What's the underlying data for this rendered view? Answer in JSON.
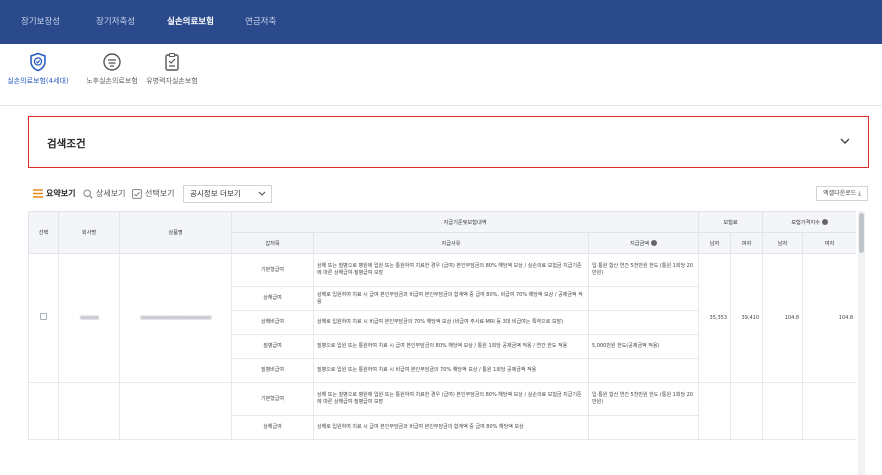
{
  "topnav": {
    "tabs": [
      {
        "label": "장기보장성",
        "active": false
      },
      {
        "label": "장기저축성",
        "active": false
      },
      {
        "label": "실손의료보험",
        "active": true
      },
      {
        "label": "연금저축",
        "active": false
      }
    ]
  },
  "subnav": {
    "items": [
      {
        "label": "실손의료보험(4세대)",
        "icon": "shield-check-icon",
        "active": true
      },
      {
        "label": "노후실손의료보험",
        "icon": "elderly-face-icon",
        "active": false
      },
      {
        "label": "유병력자실손보험",
        "icon": "clipboard-icon",
        "active": false
      }
    ]
  },
  "search": {
    "title": "검색조건"
  },
  "toolbar": {
    "summary": "요약보기",
    "detail": "상세보기",
    "select": "선택보기",
    "disclosure": "공시정보 더보기",
    "excel": "엑셀다운로드"
  },
  "table": {
    "headers": {
      "select": "선택",
      "company": "회사명",
      "product": "상품명",
      "coverage_group": "지급기준및보험내역",
      "premium_group": "보험료",
      "index_group": "보험가격지수",
      "coverage_type": "갑저목",
      "payment_reason": "지급사유",
      "payment_amount": "지급금액",
      "male": "남자",
      "female": "여자"
    },
    "rows": [
      {
        "type": "기본형급여",
        "reason": "상해 또는 질병으로 병원에 입원 또는 통원하여 치료한 경우 (급여) 본인부담금의 80% 해당액 보상 / 실손의료 보험금 지급기준에 따른 상해급여·질병급여 보장",
        "amount": "입·통원 합산 연간 5천만원 한도 (통원 1회당 20만원)"
      },
      {
        "type": "상해급여",
        "reason": "상해로 입원하여 치료 시 급여 본인부담금과 비급여 본인부담금의 합계액 중 급여 80%, 비급여 70% 해당액 보상 / 공제금액 적용",
        "amount": ""
      },
      {
        "type": "상해비급여",
        "reason": "상해로 입원하여 치료 시 비급여 본인부담금의 70% 해당액 보상 (비급여 주사료·MRI 등 3대 비급여는 특약으로 보장)",
        "amount": ""
      },
      {
        "type": "질병급여",
        "reason": "질병으로 입원 또는 통원하여 치료 시 급여 본인부담금의 80% 해당액 보상 / 통원 1회당 공제금액 적용 / 연간 한도 적용",
        "amount": "5,000만원 한도(공제금액 적용)"
      },
      {
        "type": "질병비급여",
        "reason": "질병으로 입원 또는 통원하여 치료 시 비급여 본인부담금의 70% 해당액 보상 / 통원 1회당 공제금액 적용",
        "amount": ""
      },
      {
        "type": "기본형급여",
        "reason": "상해 또는 질병으로 병원에 입원 또는 통원하여 치료한 경우 (급여) 본인부담금의 80% 해당액 보상 / 실손의료 보험금 지급기준에 따른 상해급여·질병급여 보장",
        "amount": "입·통원 합산 연간 5천만원 한도 (통원 1회당 20만원)"
      },
      {
        "type": "상해급여",
        "reason": "상해로 입원하여 치료 시 급여 본인부담금과 비급여 본인부담금의 합계액 중 급여 80% 해당액 보상",
        "amount": ""
      }
    ],
    "product1": {
      "company": "■■■■■",
      "name": "■■■■■■■■■■■■■■■■■■■",
      "premium_male": "35,353",
      "premium_female": "39,410",
      "index_male": "104.8",
      "index_female": "104.8"
    }
  }
}
